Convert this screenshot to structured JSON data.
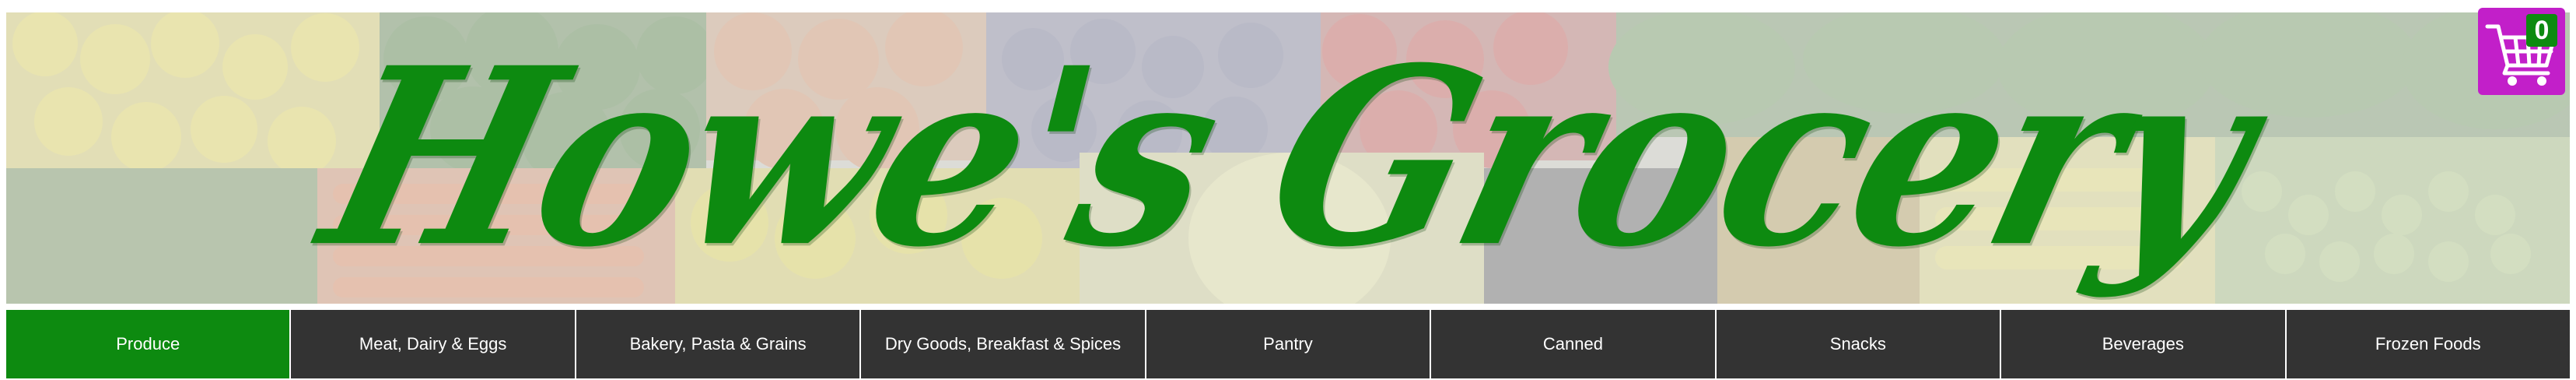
{
  "brand": {
    "title": "Howe's Grocery",
    "title_color": "#0d8a10"
  },
  "cart": {
    "icon": "shopping-cart-icon",
    "count": "0",
    "background": "#c21fc9",
    "badge_color": "#0d8a10"
  },
  "nav": {
    "active_color": "#0d8a10",
    "inactive_color": "#333333",
    "items": [
      {
        "label": "Produce",
        "active": true
      },
      {
        "label": "Meat, Dairy & Eggs",
        "active": false
      },
      {
        "label": "Bakery, Pasta & Grains",
        "active": false
      },
      {
        "label": "Dry Goods, Breakfast & Spices",
        "active": false
      },
      {
        "label": "Pantry",
        "active": false
      },
      {
        "label": "Canned",
        "active": false
      },
      {
        "label": "Snacks",
        "active": false
      },
      {
        "label": "Beverages",
        "active": false
      },
      {
        "label": "Frozen Foods",
        "active": false
      }
    ]
  }
}
